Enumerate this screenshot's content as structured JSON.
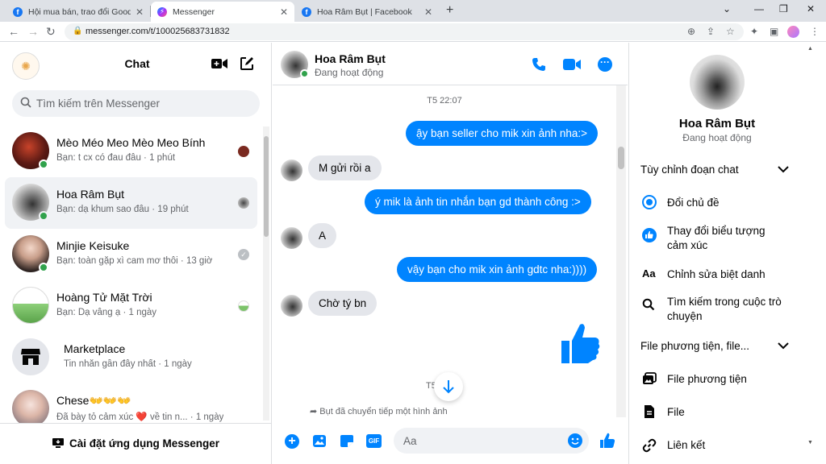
{
  "browser": {
    "tabs": [
      {
        "title": "Hội mua bán, trao đổi Goods Anime",
        "favicon": "facebook-icon",
        "active": false
      },
      {
        "title": "Messenger",
        "favicon": "messenger-icon",
        "active": true
      },
      {
        "title": "Hoa Râm Bụt | Facebook",
        "favicon": "facebook-icon",
        "active": false
      }
    ],
    "url": "messenger.com/t/100025683731832"
  },
  "sidebar": {
    "title": "Chat",
    "search_placeholder": "Tìm kiếm trên Messenger",
    "conversations": [
      {
        "name": "Mèo Méo Meo Mèo Meo Bính",
        "preview": "Bạn: t cx có đau đâu · 1 phút",
        "online": true,
        "selected": false
      },
      {
        "name": "Hoa Râm Bụt",
        "preview": "Bạn: dạ khum sao đâu · 19 phút",
        "online": true,
        "selected": true
      },
      {
        "name": "Minjie Keisuke",
        "preview": "Bạn: toàn gặp xì cam mơ thôi · 13 giờ",
        "online": true,
        "selected": false
      },
      {
        "name": "Hoàng Tử Mặt Trời",
        "preview": "Bạn: Dạ vâng ạ · 1 ngày",
        "online": false,
        "selected": false
      },
      {
        "name": "Marketplace",
        "preview": "Tin nhắn gần đây nhất · 1 ngày",
        "online": false,
        "selected": false
      },
      {
        "name": "Chese👐👐👐",
        "preview": "Đã bày tỏ cảm xúc ❤️ về tin n... · 1 ngày",
        "online": false,
        "selected": false
      }
    ],
    "install_label": "Cài đặt ứng dụng Messenger"
  },
  "chat": {
    "name": "Hoa Râm Bụt",
    "status": "Đang hoạt động",
    "timestamp": "T5 22:07",
    "messages": [
      {
        "from": "me",
        "text": "ậy bạn seller cho mik xin ảnh nha:>"
      },
      {
        "from": "them",
        "text": "M gửi rồi a"
      },
      {
        "from": "me",
        "text": "ý mik là ảnh tin nhắn bạn gd thành công :>"
      },
      {
        "from": "them",
        "text": "A"
      },
      {
        "from": "me",
        "text": "vậy bạn cho mik xin ảnh gdtc nha:))))"
      },
      {
        "from": "them",
        "text": "Chờ tý bn"
      }
    ],
    "partial_timestamp": "T5",
    "forward_notice": "Bụt đã chuyển tiếp một hình ảnh",
    "input_placeholder": "Aa"
  },
  "info_panel": {
    "name": "Hoa Râm Bụt",
    "status": "Đang hoạt động",
    "section_customize": "Tùy chỉnh đoạn chat",
    "customize_items": [
      {
        "icon": "theme-icon",
        "label": "Đổi chủ đề"
      },
      {
        "icon": "thumbs-up-icon",
        "label": "Thay đổi biểu tượng cảm xúc"
      },
      {
        "icon": "nickname-icon",
        "label": "Chỉnh sửa biệt danh"
      },
      {
        "icon": "search-icon",
        "label": "Tìm kiếm trong cuộc trò chuyện"
      }
    ],
    "section_media": "File phương tiện, file...",
    "media_items": [
      {
        "icon": "media-icon",
        "label": "File phương tiện"
      },
      {
        "icon": "file-icon",
        "label": "File"
      },
      {
        "icon": "link-icon",
        "label": "Liên kết"
      }
    ]
  },
  "colors": {
    "accent": "#0084ff",
    "online": "#31a24c",
    "bubble_in": "#e4e6eb"
  }
}
